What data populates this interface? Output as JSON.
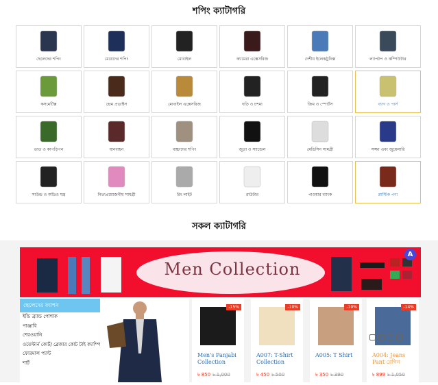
{
  "shopping_section": {
    "title": "শপিং ক্যাটাগরি",
    "categories": [
      {
        "label": "ছেলেদের শপিং",
        "icon": "mens-jacket-icon",
        "highlighted": false
      },
      {
        "label": "মেয়েদের শপিং",
        "icon": "womens-dress-icon",
        "highlighted": false
      },
      {
        "label": "মোবাইল",
        "icon": "mobile-phone-icon",
        "highlighted": false
      },
      {
        "label": "ক্যামেরা এক্সেসরিজ",
        "icon": "camera-lens-icon",
        "highlighted": false
      },
      {
        "label": "দেশীয় ইলেকট্রনিক্স",
        "icon": "television-icon",
        "highlighted": false
      },
      {
        "label": "ল্যাপটপ ও কম্পিউটার",
        "icon": "laptop-icon",
        "highlighted": false
      },
      {
        "label": "কসমেটিক্স",
        "icon": "cosmetics-icon",
        "highlighted": false
      },
      {
        "label": "হোম প্রডাক্টস",
        "icon": "wardrobe-icon",
        "highlighted": false
      },
      {
        "label": "মোবাইল এক্সেসরিজ",
        "icon": "mobile-accessories-icon",
        "highlighted": false
      },
      {
        "label": "ঘড়ি ও চশমা",
        "icon": "watch-icon",
        "highlighted": false
      },
      {
        "label": "জিম ও স্পোর্টস",
        "icon": "gym-equipment-icon",
        "highlighted": false
      },
      {
        "label": "ব্যাগ ও পার্স",
        "icon": "handbag-icon",
        "highlighted": true
      },
      {
        "label": "তাত ও কাপড়িপন",
        "icon": "fabric-icon",
        "highlighted": false
      },
      {
        "label": "যানবাহন",
        "icon": "motorcycle-icon",
        "highlighted": false
      },
      {
        "label": "বাচ্চাদের শপিং",
        "icon": "radio-icon",
        "highlighted": false
      },
      {
        "label": "জুতা ও স্যান্ডেল",
        "icon": "shoes-icon",
        "highlighted": false
      },
      {
        "label": "মেডিসিন সামগ্রী",
        "icon": "medicine-box-icon",
        "highlighted": false
      },
      {
        "label": "সজ্জা এবং জুয়েলারি",
        "icon": "jewelry-icon",
        "highlighted": false
      },
      {
        "label": "সাউন্ড ও অডিও যন্ত্র",
        "icon": "speaker-system-icon",
        "highlighted": false
      },
      {
        "label": "নিত্যপ্রয়োজনীয় সামগ্রী",
        "icon": "soap-icon",
        "highlighted": false
      },
      {
        "label": "রিং লাইট",
        "icon": "ring-light-icon",
        "highlighted": false
      },
      {
        "label": "রাউটার",
        "icon": "router-icon",
        "highlighted": false
      },
      {
        "label": "পাওয়ার ব্যাংক",
        "icon": "power-bank-icon",
        "highlighted": false
      },
      {
        "label": "প্লাস্টিক পণ্য",
        "icon": "plastic-chair-icon",
        "highlighted": true
      }
    ]
  },
  "all_section": {
    "title": "সকল ক্যাটাগরি"
  },
  "banner": {
    "title": "Men Collection",
    "badge": "A"
  },
  "mens_fashion": {
    "heading": "ছেলেদের ফ্যাশন",
    "items": [
      "ইন্ডি ব্র্যান্ড পোশাক",
      "পাঞ্জাবি",
      "শেরওয়ানি",
      "ওয়েস্টার্ন কোর্ট/ ব্লেজার কোট টাই ক্যাম্পিং",
      "ফোরমাল প্যান্ট",
      "শার্ট"
    ]
  },
  "products": [
    {
      "name": "Men's Panjabi Collection",
      "price": "৳ 850",
      "old_price": "৳ 1,000",
      "discount": "-15%",
      "accent": "blue"
    },
    {
      "name": "A007: T-Shirt Collection",
      "price": "৳ 450",
      "old_price": "৳ 500",
      "discount": "-10%",
      "accent": "blue"
    },
    {
      "name": "A005: T Shirt",
      "price": "৳ 350",
      "old_price": "৳ 390",
      "discount": "-10%",
      "accent": "blue"
    },
    {
      "name": "A004: Jeans Pant রেগিন",
      "price": "৳ 899",
      "old_price": "৳ 1,050",
      "discount": "-14%",
      "accent": "orange"
    }
  ],
  "colors": {
    "banner_red": "#f20f2e",
    "category_header": "#6ec6f0",
    "discount_red": "#ee3b24",
    "link_blue": "#2a6ab0",
    "highlight_gold": "#e8c14a"
  }
}
